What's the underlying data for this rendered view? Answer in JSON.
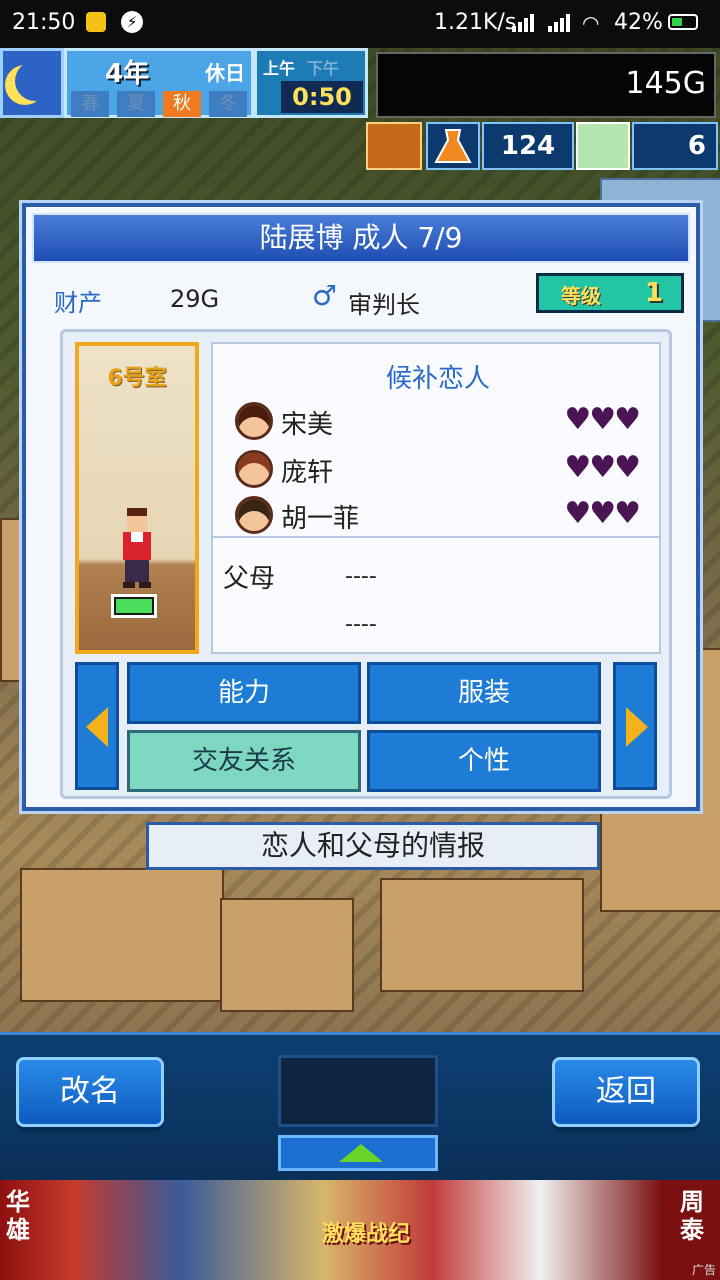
{
  "status_bar": {
    "time": "21:50",
    "network_speed": "1.21K/s",
    "battery": "42%"
  },
  "hud": {
    "year": "4年",
    "holiday": "休日",
    "seasons": [
      "春",
      "夏",
      "秋",
      "冬"
    ],
    "active_season": "秋",
    "am_label": "上午",
    "pm_label": "下午",
    "clock": "0:50",
    "gold": "145G",
    "potion_count": "124",
    "ticket_count": "6"
  },
  "dialog": {
    "title": "陆展博 成人 7/9",
    "property_label": "财产",
    "property_value": "29G",
    "job_icon": "♂",
    "job": "审判长",
    "level_label": "等级",
    "level_value": "1",
    "room_name": "6号室",
    "lovers_title": "候补恋人",
    "lovers": [
      {
        "name": "宋美",
        "hearts": "♥♥♥"
      },
      {
        "name": "庞轩",
        "hearts": "♥♥♥"
      },
      {
        "name": "胡一菲",
        "hearts": "♥♥♥"
      }
    ],
    "parents_label": "父母",
    "parents": [
      "----",
      "----"
    ],
    "tabs": {
      "ability": "能力",
      "clothing": "服装",
      "relations": "交友关系",
      "personality": "个性"
    }
  },
  "hint": "恋人和父母的情报",
  "bottom": {
    "rename": "改名",
    "back": "返回"
  },
  "ad": {
    "left_vertical": "华雄",
    "right_vertical": "周泰",
    "logo": "激爆战纪",
    "tag": "广告"
  },
  "colors": {
    "dialog_border": "#2a5ca8",
    "tab_blue": "#1e7bd6",
    "tab_active": "#7ed7c0",
    "level_box": "#22c6a4",
    "hearts": "#4a1552"
  }
}
